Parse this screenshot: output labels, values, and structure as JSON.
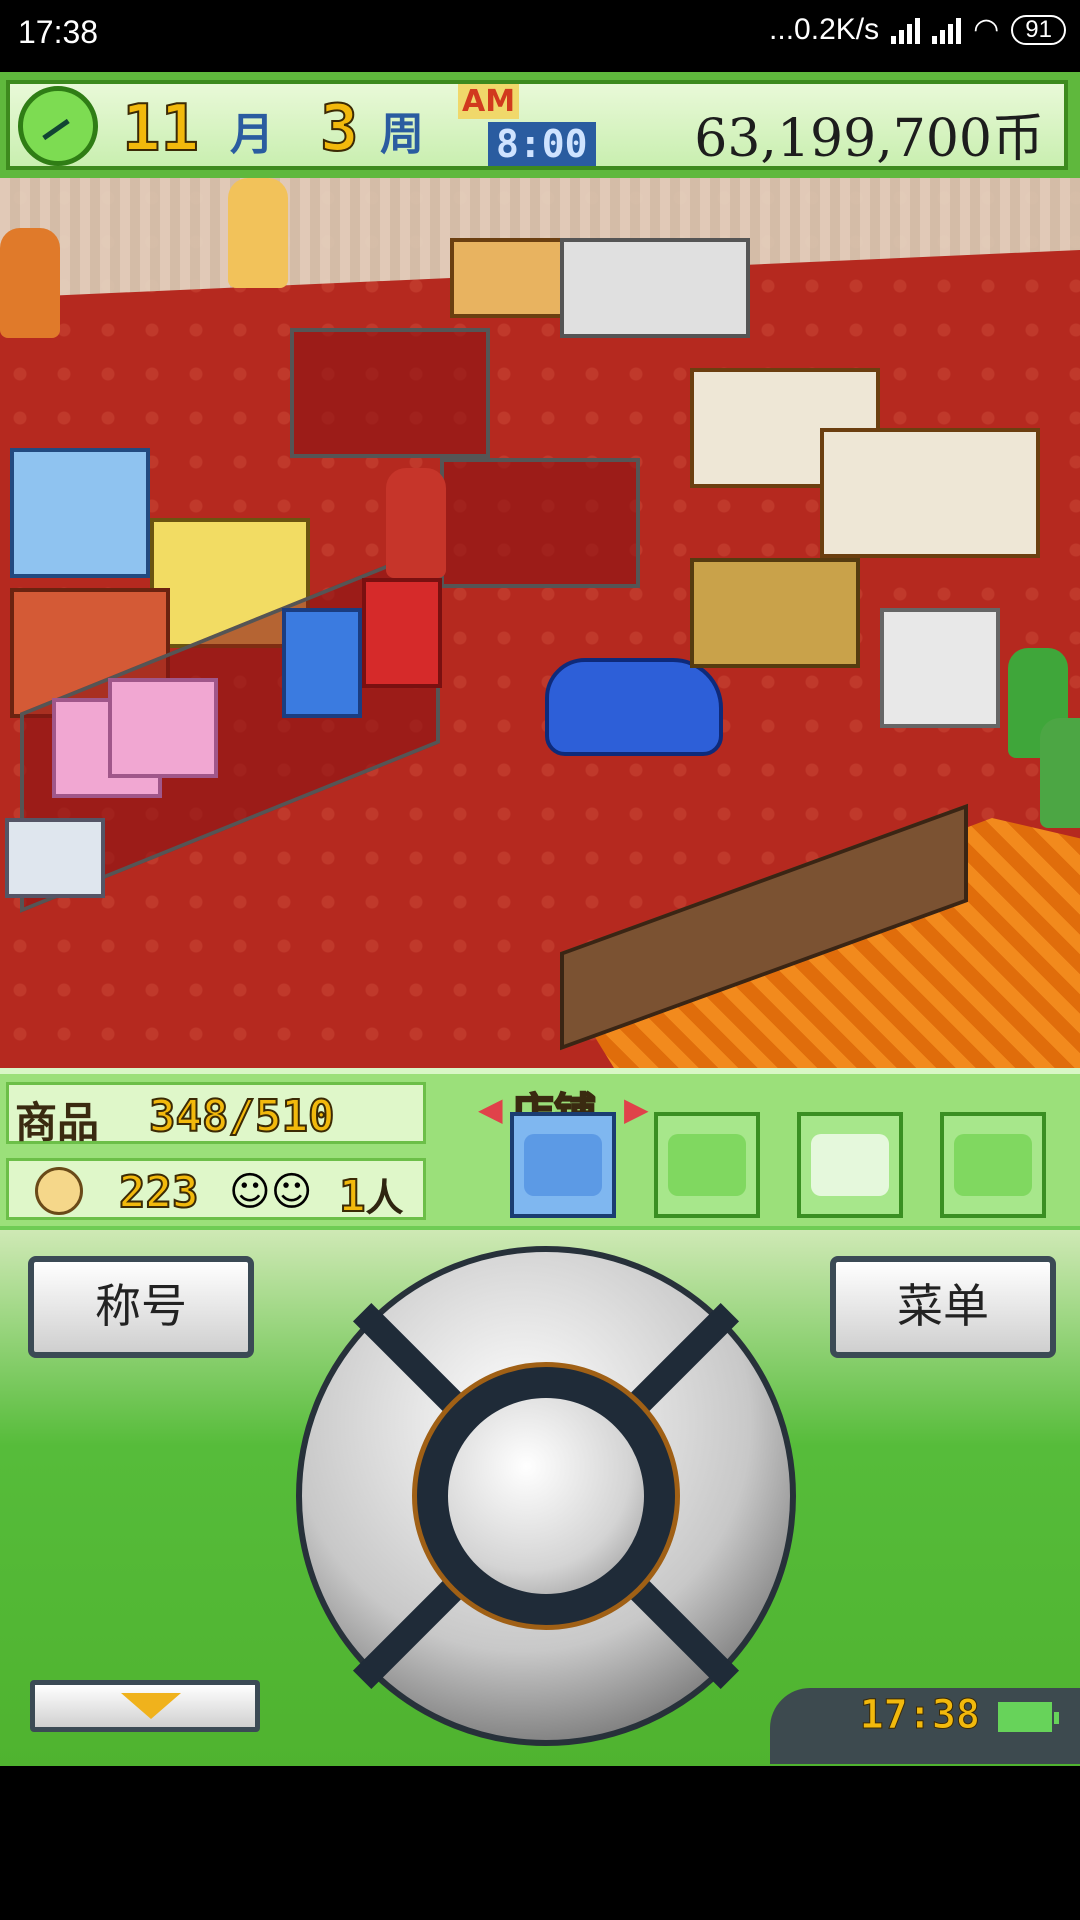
{
  "status_bar": {
    "time": "17:38",
    "network_speed": "...0.2K/s",
    "battery": "91"
  },
  "hud": {
    "month": "11",
    "month_unit": "月",
    "week": "3",
    "week_unit": "周",
    "ampm": "AM",
    "clock": "8:00",
    "money": "63,199,700币"
  },
  "info": {
    "goods_label": "商品",
    "goods_value": "348/510",
    "fans_value": "223",
    "people_value": "1",
    "people_unit": "人"
  },
  "tabs": {
    "active_label": "店铺",
    "items": [
      "shop-tab",
      "money-tab",
      "chat-tab",
      "map-tab"
    ]
  },
  "controls": {
    "title_button": "称号",
    "menu_button": "菜单"
  },
  "pad_clock": "17:38",
  "colors": {
    "hud_green": "#5fb83d",
    "floor_red": "#b5291f",
    "pad_green": "#56bc3a",
    "digit_gold": "#f2b90c"
  }
}
